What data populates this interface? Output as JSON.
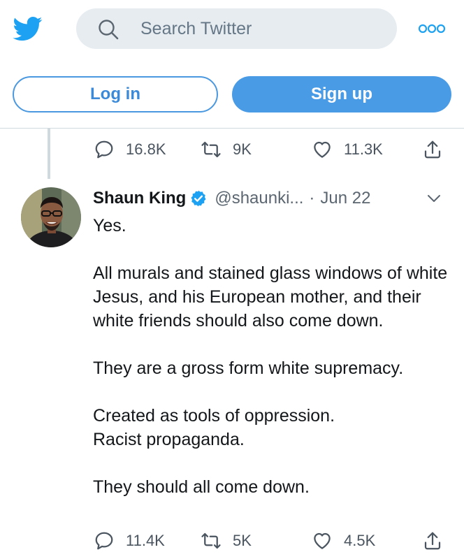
{
  "header": {
    "search_placeholder": "Search Twitter",
    "logo_icon": "twitter-bird-icon",
    "more_icon": "more-dots-icon"
  },
  "auth": {
    "login_label": "Log in",
    "signup_label": "Sign up"
  },
  "colors": {
    "brand_blue": "#1da1f2",
    "button_blue": "#4a9be6",
    "text_dark": "#14171a",
    "text_muted": "#5b6670",
    "search_bg": "#e6ecf0"
  },
  "previous_tweet": {
    "replies": "16.8K",
    "retweets": "9K",
    "likes": "11.3K"
  },
  "tweet": {
    "name": "Shaun King",
    "handle": "@shaunki...",
    "separator": "·",
    "date": "Jun 22",
    "paragraphs": [
      "Yes.",
      "All murals and stained glass windows of white Jesus, and his European mother, and their white friends should also come down.",
      "They are a gross form white supremacy.",
      "Created as tools of oppression.",
      "Racist propaganda.",
      "They should all come down."
    ],
    "replies": "11.4K",
    "retweets": "5K",
    "likes": "4.5K"
  }
}
